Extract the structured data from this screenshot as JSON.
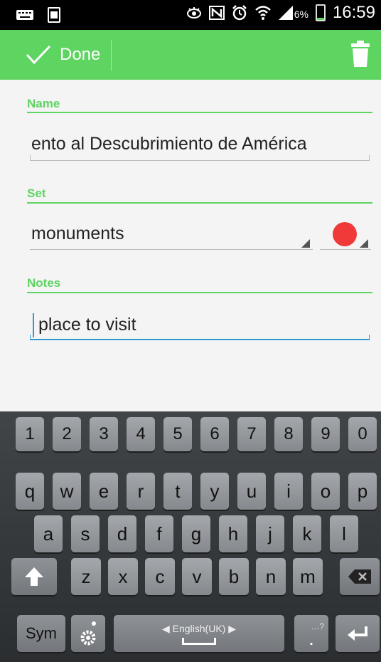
{
  "status_bar": {
    "battery_percent": "6%",
    "time": "16:59",
    "icons": [
      "keyboard-icon",
      "screenshot-icon",
      "eye-icon",
      "nfc-icon",
      "alarm-icon",
      "wifi-icon",
      "signal-icon",
      "battery-icon"
    ]
  },
  "action_bar": {
    "done_label": "Done",
    "icons": [
      "check-icon",
      "trash-icon"
    ],
    "color": "#5ed461"
  },
  "form": {
    "name": {
      "label": "Name",
      "value": "ento al Descubrimiento de América"
    },
    "set": {
      "label": "Set",
      "value": "monuments",
      "color_swatch": "#f03a3a"
    },
    "notes": {
      "label": "Notes",
      "value": "place to visit"
    }
  },
  "keyboard": {
    "numbers": [
      "1",
      "2",
      "3",
      "4",
      "5",
      "6",
      "7",
      "8",
      "9",
      "0"
    ],
    "row1": [
      "q",
      "w",
      "e",
      "r",
      "t",
      "y",
      "u",
      "i",
      "o",
      "p"
    ],
    "row2": [
      "a",
      "s",
      "d",
      "f",
      "g",
      "h",
      "j",
      "k",
      "l"
    ],
    "row3": [
      "z",
      "x",
      "c",
      "v",
      "b",
      "n",
      "m"
    ],
    "sym_label": "Sym",
    "language_label": "English(UK)",
    "period_label": ".",
    "period_hint": "…?"
  }
}
